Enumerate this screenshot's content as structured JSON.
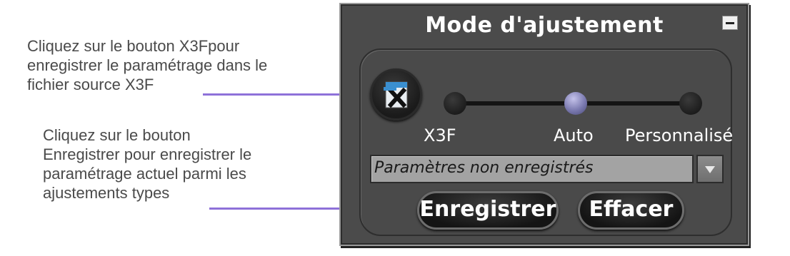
{
  "annotations": {
    "note1_lines": [
      "Cliquez sur le bouton X3Fpour",
      "enregistrer le paramétrage dans le",
      "fichier source X3F"
    ],
    "note2_lines": [
      "Cliquez sur le bouton",
      "Enregistrer pour enregistrer le",
      "paramétrage actuel parmi les",
      "ajustements types"
    ],
    "arrow_color": "#8e71d9"
  },
  "panel": {
    "title": "Mode d'ajustement",
    "mode_slider": {
      "options": [
        "X3F",
        "Auto",
        "Personnalisé"
      ],
      "selected": "Auto"
    },
    "preset": {
      "value": "Paramètres non enregistrés"
    },
    "buttons": {
      "save_label": "Enregistrer",
      "clear_label": "Effacer"
    },
    "icons": {
      "x3f_button": "x3f-file-icon",
      "dropdown": "chevron-down-icon",
      "collapse": "minimize-icon"
    }
  }
}
